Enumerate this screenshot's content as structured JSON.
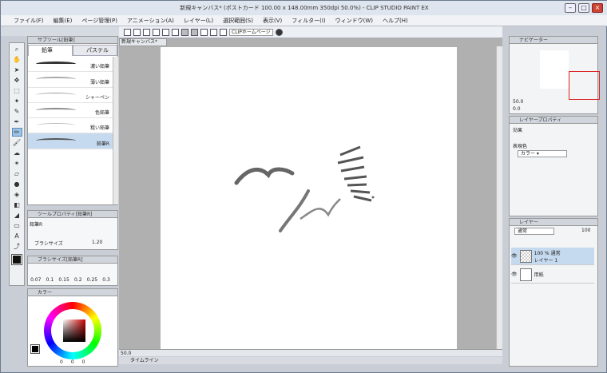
{
  "window": {
    "title": "新規キャンバス* (ポストカード 100.00 x 148.00mm 350dpi 50.0%) - CLIP STUDIO PAINT EX"
  },
  "menu": [
    "ファイル(F)",
    "編集(E)",
    "ページ管理(P)",
    "アニメーション(A)",
    "レイヤー(L)",
    "選択範囲(S)",
    "表示(V)",
    "フィルター(I)",
    "ウィンドウ(W)",
    "ヘルプ(H)"
  ],
  "cmdbar": {
    "clip_button": "CLIPホームページ"
  },
  "subtool": {
    "header": "サブツール[鉛筆]",
    "tabs": [
      "鉛筆",
      "パステル"
    ],
    "brushes": [
      "濃い鉛筆",
      "薄い鉛筆",
      "シャーペン",
      "色鉛筆",
      "粗い鉛筆",
      "鉛筆R"
    ],
    "selected_index": 5
  },
  "toolprop": {
    "header": "ツールプロパティ[鉛筆R]",
    "tool_name": "鉛筆R",
    "brush_size_label": "ブラシサイズ",
    "brush_size_value": "1.20"
  },
  "brushsize": {
    "header": "ブラシサイズ[鉛筆R]",
    "sizes": [
      "0.07",
      "0.1",
      "0.15",
      "0.2",
      "0.25",
      "0.3"
    ]
  },
  "color": {
    "header": "カラー",
    "values": [
      "0",
      "0",
      "0"
    ]
  },
  "canvas": {
    "tab": "新規キャンバス*",
    "zoom": "50.0",
    "timeline": "タイムライン"
  },
  "navigator": {
    "tab": "ナビゲーター",
    "zoom": "50.0",
    "rotation": "0.0"
  },
  "layerprop": {
    "tab": "レイヤープロパティ",
    "effect_label": "効果",
    "color_label": "表現色",
    "color_value": "カラー"
  },
  "layers": {
    "tab": "レイヤー",
    "blend_mode": "通常",
    "opacity": "100",
    "items": [
      {
        "mode": "100 % 通常",
        "name": "レイヤー 1"
      },
      {
        "mode": "",
        "name": "用紙"
      }
    ]
  }
}
